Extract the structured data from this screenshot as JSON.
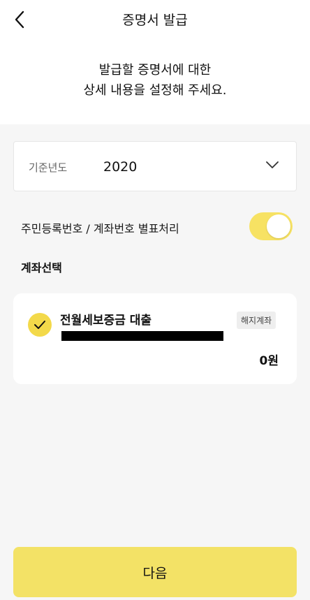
{
  "header": {
    "title": "증명서 발급",
    "back_icon": "chevron-left-icon"
  },
  "intro": {
    "line1": "발급할 증명서에 대한",
    "line2": "상세 내용을 설정해 주세요."
  },
  "year_select": {
    "label": "기준년도",
    "value": "2020",
    "icon": "chevron-down-icon"
  },
  "mask_option": {
    "label": "주민등록번호 / 계좌번호 별표처리",
    "enabled": true
  },
  "account_section": {
    "title": "계좌선택",
    "accounts": [
      {
        "name": "전월세보증금 대출",
        "badge": "해지계좌",
        "balance": "0원",
        "selected": true
      }
    ]
  },
  "footer": {
    "next_label": "다음"
  },
  "colors": {
    "accent_yellow": "#f3e266",
    "toggle_yellow": "#f7e263",
    "background": "#f6f6f6"
  }
}
